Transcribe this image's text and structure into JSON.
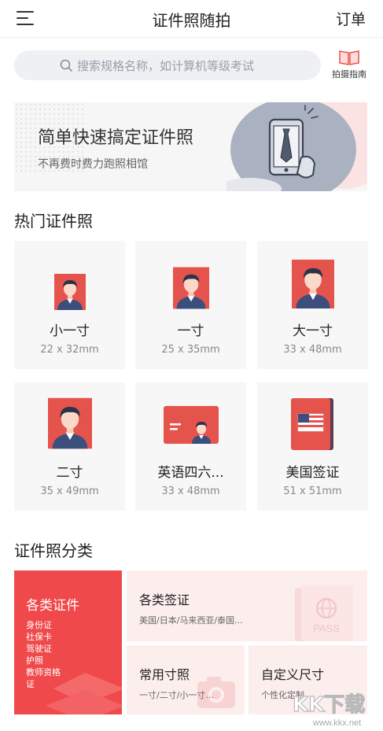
{
  "header": {
    "title": "证件照随拍",
    "right_label": "订单",
    "menu_icon": "menu-icon"
  },
  "search": {
    "placeholder": "搜索规格名称，如计算机等级考试",
    "icon": "search-icon"
  },
  "guide": {
    "label": "拍摄指南",
    "icon": "book-icon"
  },
  "banner": {
    "title": "简单快速搞定证件照",
    "subtitle": "不再费时费力跑照相馆"
  },
  "hot_section": {
    "title": "热门证件照",
    "items": [
      {
        "name": "小一寸",
        "size": "22 x 32mm",
        "icon": "portrait-icon"
      },
      {
        "name": "一寸",
        "size": "25 x 35mm",
        "icon": "portrait-icon"
      },
      {
        "name": "大一寸",
        "size": "33 x 48mm",
        "icon": "portrait-icon"
      },
      {
        "name": "二寸",
        "size": "35 x 49mm",
        "icon": "portrait-icon"
      },
      {
        "name": "英语四六...",
        "size": "33 x 48mm",
        "icon": "id-card-icon"
      },
      {
        "name": "美国签证",
        "size": "51 x 51mm",
        "icon": "us-passport-icon"
      }
    ]
  },
  "category_section": {
    "title": "证件照分类",
    "main": {
      "title": "各类证件",
      "items": [
        "身份证",
        "社保卡",
        "驾驶证",
        "护照",
        "教师资格",
        "证"
      ]
    },
    "visa": {
      "title": "各类签证",
      "subtitle": "美国/日本/马来西亚/泰国...",
      "deco_text": "PASS"
    },
    "common": {
      "title": "常用寸照",
      "subtitle": "一寸/二寸/小一寸..."
    },
    "custom": {
      "title": "自定义尺寸",
      "subtitle": "个性化定制"
    }
  },
  "watermark": {
    "text": "KK下载",
    "url": "www.kkx.net"
  },
  "colors": {
    "accent": "#f0494b",
    "portrait_bg": "#e5534d",
    "card_bg": "#f7f7f7",
    "pink_bg": "#fdeeee"
  }
}
